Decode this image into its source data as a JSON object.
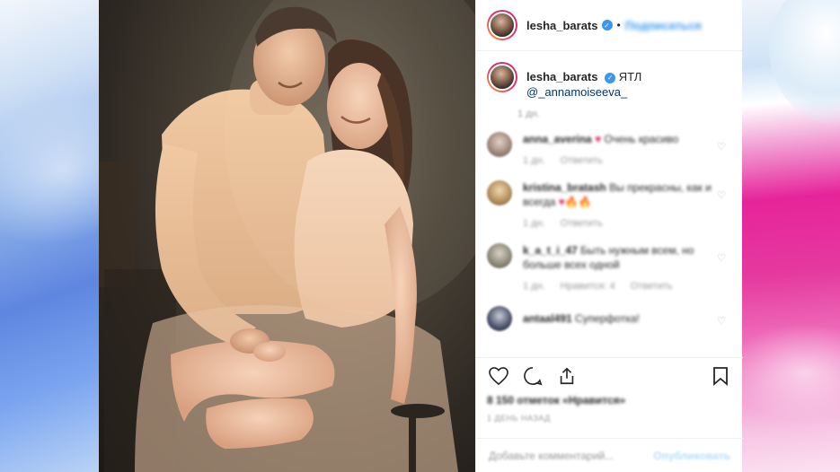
{
  "post": {
    "username": "lesha_barats",
    "follow_label": "Подписаться",
    "separator": "•",
    "caption": {
      "text": "ЯТЛ",
      "mention": "@_annamoiseeva_"
    },
    "caption_time": "1 дн."
  },
  "comments": [
    {
      "username": "anna_averina",
      "text": "Очень красиво",
      "emoji": "♥",
      "time": "1 дн.",
      "reply": "Ответить"
    },
    {
      "username": "kristina_bratash",
      "text": "Вы прекрасны, как и всегда",
      "emoji": "♥🔥🔥",
      "time": "1 дн.",
      "reply": "Ответить"
    },
    {
      "username": "k_a_t_i_47",
      "text": "Быть нужным всем, но больше всех одной",
      "emoji": "",
      "time": "1 дн.",
      "likes": "Нравится: 4",
      "reply": "Ответить"
    },
    {
      "username": "antaal491",
      "text": "Суперфотка!",
      "emoji": "",
      "time": "",
      "reply": ""
    }
  ],
  "actions": {
    "likes_text": "8 150 отметок «Нравится»",
    "date_text": "1 ДЕНЬ НАЗАД",
    "add_comment_placeholder": "Добавьте комментарий...",
    "post_label": "Опубликовать"
  },
  "icons": {
    "like": "heart-icon",
    "comment": "comment-icon",
    "share": "share-icon",
    "save": "bookmark-icon",
    "verified": "verified-badge-icon"
  },
  "colors": {
    "link_blue": "#3897f0",
    "heart_red": "#e0245e",
    "text": "#262626",
    "muted": "#999999"
  }
}
